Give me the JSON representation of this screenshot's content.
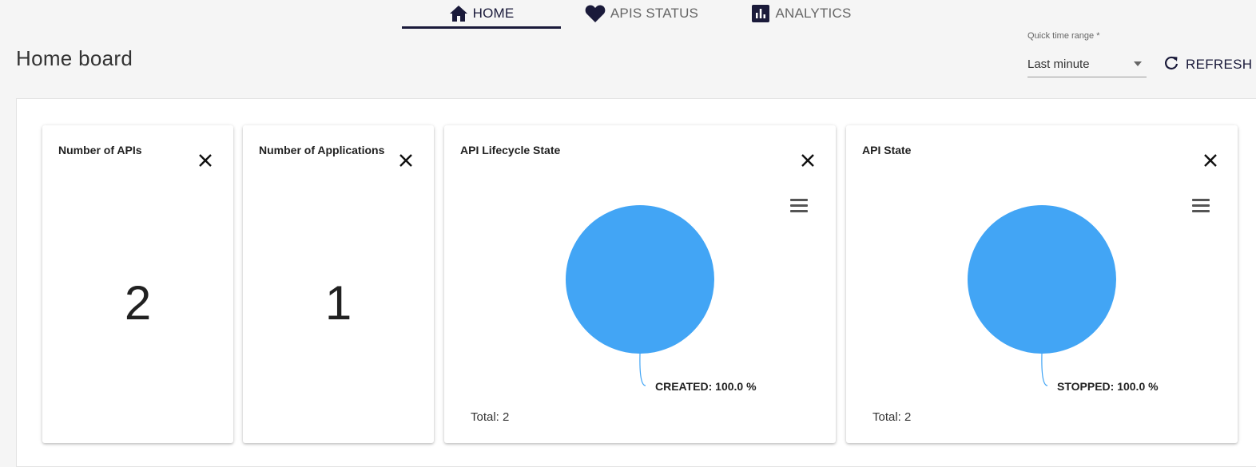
{
  "tabs": [
    {
      "label": "HOME",
      "icon": "home-icon",
      "active": true
    },
    {
      "label": "APIS STATUS",
      "icon": "heart-icon",
      "active": false
    },
    {
      "label": "ANALYTICS",
      "icon": "bar-chart-icon",
      "active": false
    }
  ],
  "header": {
    "title": "Home board",
    "time_range": {
      "label": "Quick time range *",
      "value": "Last minute"
    },
    "refresh_label": "REFRESH"
  },
  "widgets": [
    {
      "title": "Number of APIs",
      "value": "2"
    },
    {
      "title": "Number of Applications",
      "value": "1"
    },
    {
      "title": "API Lifecycle State",
      "total": "Total: 2",
      "slice_label": "CREATED: 100.0 %"
    },
    {
      "title": "API State",
      "total": "Total: 2",
      "slice_label": "STOPPED: 100.0 %"
    }
  ],
  "chart_data": [
    {
      "type": "pie",
      "title": "API Lifecycle State",
      "slices": [
        {
          "label": "CREATED",
          "value": 100.0
        }
      ],
      "colors": [
        "#42a5f5"
      ]
    },
    {
      "type": "pie",
      "title": "API State",
      "slices": [
        {
          "label": "STOPPED",
          "value": 100.0
        }
      ],
      "colors": [
        "#42a5f5"
      ]
    }
  ],
  "colors": {
    "accent": "#1a1a3a",
    "pie": "#42a5f5"
  }
}
